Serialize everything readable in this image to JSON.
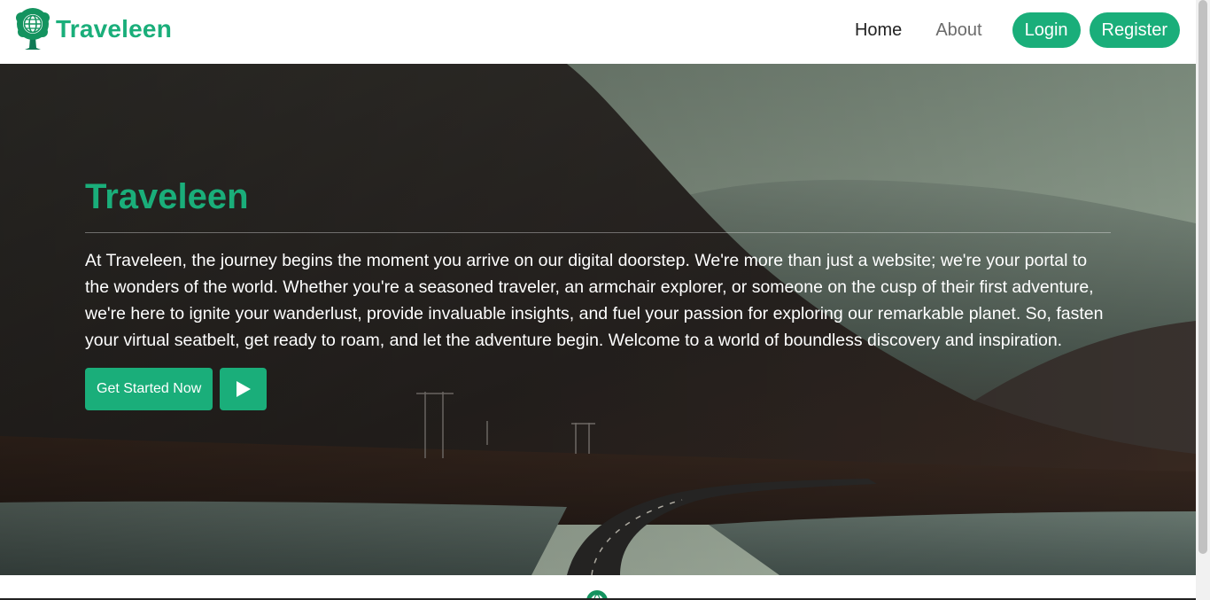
{
  "brand": {
    "name": "Traveleen",
    "logo_icon": "globe-tree-icon",
    "color": "#1aae7a"
  },
  "nav": {
    "home": "Home",
    "about": "About",
    "login": "Login",
    "register": "Register"
  },
  "hero": {
    "title": "Traveleen",
    "text": "At Traveleen, the journey begins the moment you arrive on our digital doorstep. We're more than just a website; we're your portal to the wonders of the world. Whether you're a seasoned traveler, an armchair explorer, or someone on the cusp of their first adventure, we're here to ignite your wanderlust, provide invaluable insights, and fuel your passion for exploring our remarkable planet. So, fasten your virtual seatbelt, get ready to roam, and let the adventure begin. Welcome to a world of boundless discovery and inspiration.",
    "cta_label": "Get Started Now",
    "play_icon": "play-icon",
    "background": "mountain-road-lake-photo"
  },
  "colors": {
    "accent": "#1aae7a",
    "nav_text": "#222222",
    "nav_muted": "#6b6b6b"
  }
}
